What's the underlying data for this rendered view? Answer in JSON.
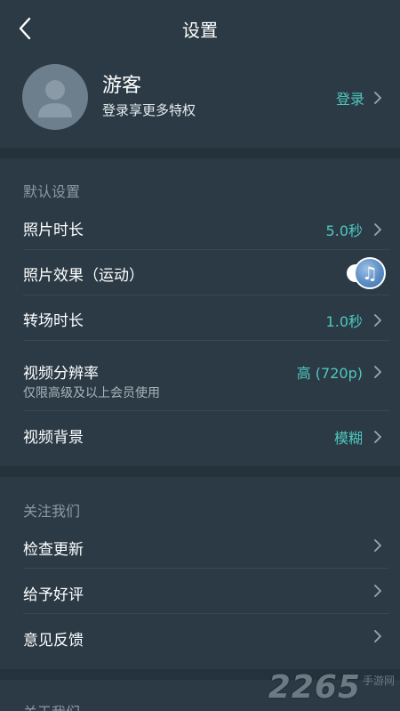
{
  "header": {
    "title": "设置"
  },
  "profile": {
    "name": "游客",
    "subtitle": "登录享更多特权",
    "login_label": "登录"
  },
  "default_settings": {
    "title": "默认设置",
    "photo_duration": {
      "label": "照片时长",
      "value": "5.0秒"
    },
    "photo_effect": {
      "label": "照片效果（运动）",
      "enabled": true
    },
    "transition_duration": {
      "label": "转场时长",
      "value": "1.0秒"
    },
    "video_resolution": {
      "label": "视频分辨率",
      "sublabel": "仅限高级及以上会员使用",
      "value": "高 (720p)"
    },
    "video_background": {
      "label": "视频背景",
      "value": "模糊"
    }
  },
  "follow_us": {
    "title": "关注我们",
    "items": [
      {
        "label": "检查更新"
      },
      {
        "label": "给予好评"
      },
      {
        "label": "意见反馈"
      }
    ]
  },
  "about": {
    "title": "关于我们"
  },
  "watermark": {
    "number": "2265",
    "text": "手游网"
  },
  "colors": {
    "background": "#2b3a44",
    "accent": "#4fc8c0",
    "divider": "#3a4852"
  }
}
